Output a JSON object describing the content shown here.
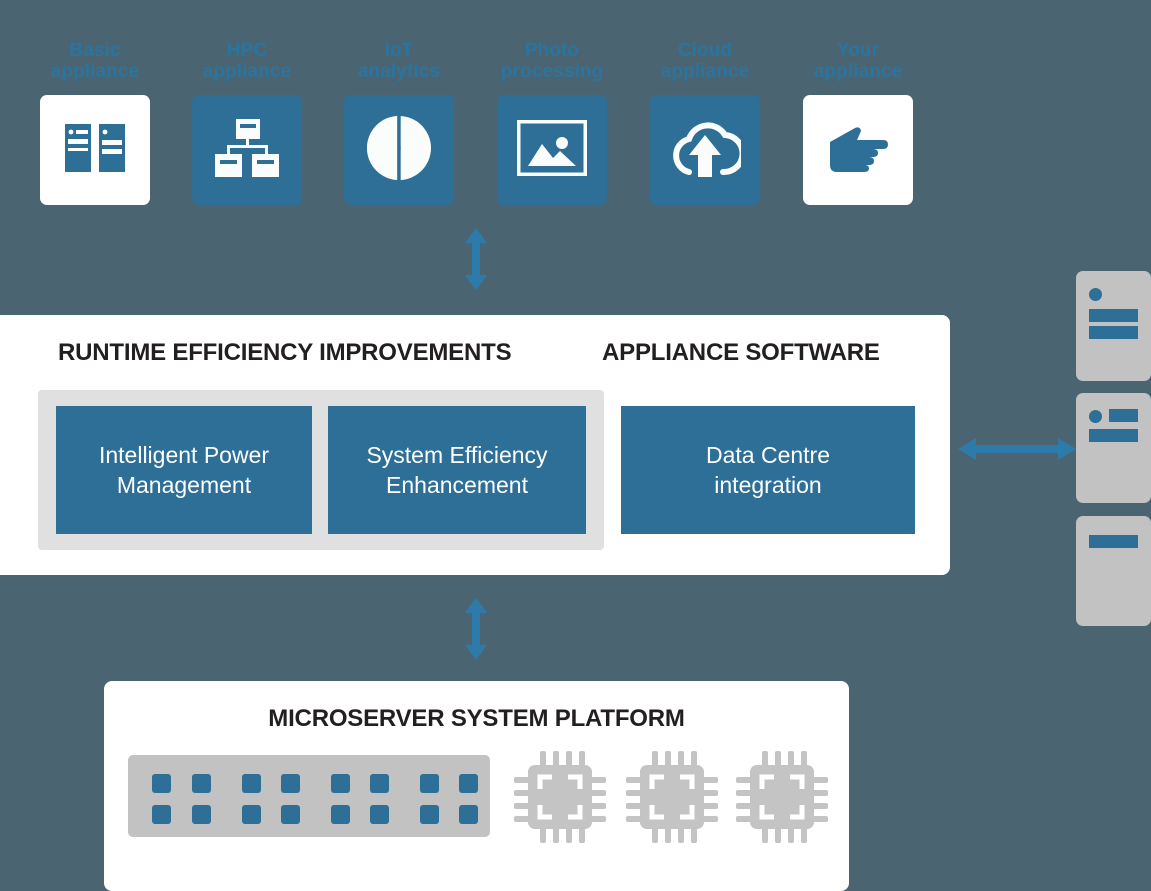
{
  "diagram": {
    "background_color": "#4a6571",
    "accent_color": "#2d6f96",
    "label_color": "#2b74a0",
    "panel_color": "#ffffff",
    "group_color": "#e0e0e0",
    "hardware_color": "#c2c2c2"
  },
  "appliances": [
    {
      "label": "Basic\nappliance",
      "icon": "servers-icon",
      "tile_style": "white"
    },
    {
      "label": "HPC\nappliance",
      "icon": "hierarchy-icon",
      "tile_style": "blue"
    },
    {
      "label": "IoT\nanalytics",
      "icon": "pie-chart-icon",
      "tile_style": "blue"
    },
    {
      "label": "Photo\nprocessing",
      "icon": "image-icon",
      "tile_style": "blue"
    },
    {
      "label": "Cloud\nappliance",
      "icon": "cloud-upload-icon",
      "tile_style": "blue"
    },
    {
      "label": "Your\nappliance",
      "icon": "pointing-hand-icon",
      "tile_style": "white"
    }
  ],
  "middle_panel": {
    "runtime_heading": "RUNTIME EFFICIENCY IMPROVEMENTS",
    "appliance_heading": "APPLIANCE SOFTWARE",
    "runtime_boxes": [
      {
        "label": "Intelligent Power\nManagement"
      },
      {
        "label": "System Efficiency\nEnhancement"
      }
    ],
    "appliance_boxes": [
      {
        "label": "Data Centre\nintegration"
      }
    ]
  },
  "bottom_panel": {
    "heading": "MICROSERVER SYSTEM PLATFORM",
    "board": {
      "rows": 2,
      "columns": 8,
      "column_pairs": 4
    },
    "cpus": [
      {
        "name": "cpu-chip-1"
      },
      {
        "name": "cpu-chip-2"
      },
      {
        "name": "cpu-chip-3"
      }
    ]
  },
  "server_stack": [
    {
      "name": "server-unit-1",
      "detail": "led-and-two-bars"
    },
    {
      "name": "server-unit-2",
      "detail": "led-bar-and-bar"
    },
    {
      "name": "server-unit-3",
      "detail": "single-bar"
    }
  ],
  "connectors": [
    {
      "name": "appliances-to-software-arrow",
      "orientation": "vertical"
    },
    {
      "name": "software-to-platform-arrow",
      "orientation": "vertical"
    },
    {
      "name": "software-to-datacentre-arrow",
      "orientation": "horizontal"
    }
  ]
}
